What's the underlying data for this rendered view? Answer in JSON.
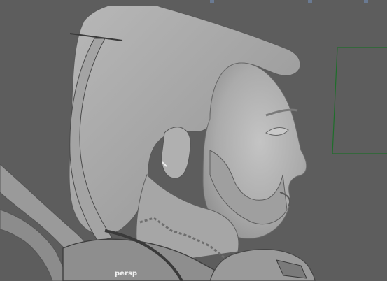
{
  "viewport": {
    "camera_name": "persp",
    "background_color": "#5d5d5d",
    "model_color": "#a9a9a9",
    "wire_color": "#1e6e2a"
  },
  "icons": {
    "top_markers": "viewport-frame-markers"
  }
}
